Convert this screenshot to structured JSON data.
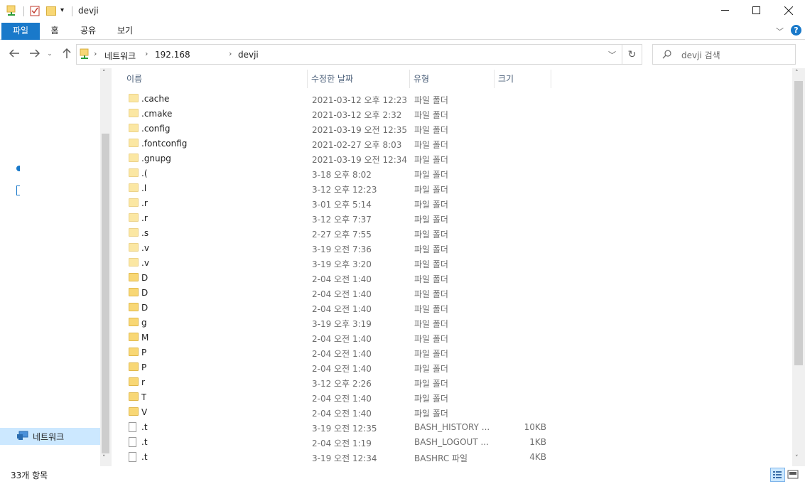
{
  "window": {
    "title": "devji",
    "minimize_icon": "minimize-icon",
    "maximize_icon": "maximize-icon",
    "close_icon": "close-icon"
  },
  "ribbon": {
    "tabs": [
      "파일",
      "홈",
      "공유",
      "보기"
    ],
    "active_tab": "파일",
    "accent_color": "#1979ca"
  },
  "address": {
    "breadcrumbs": [
      "네트워크",
      "192.168",
      "devji"
    ],
    "search_placeholder": "devji 검색"
  },
  "nav": {
    "network_label": "네트워크"
  },
  "columns": {
    "name": "이름",
    "date": "수정한 날짜",
    "type": "유형",
    "size": "크기"
  },
  "files": [
    {
      "name": ".cache",
      "date": "2021-03-12 오후 12:23",
      "type": "파일 폴더",
      "size": "",
      "kind": "folder"
    },
    {
      "name": ".cmake",
      "date": "2021-03-12 오후 2:32",
      "type": "파일 폴더",
      "size": "",
      "kind": "folder"
    },
    {
      "name": ".config",
      "date": "2021-03-19 오전 12:35",
      "type": "파일 폴더",
      "size": "",
      "kind": "folder"
    },
    {
      "name": ".fontconfig",
      "date": "2021-02-27 오후 8:03",
      "type": "파일 폴더",
      "size": "",
      "kind": "folder"
    },
    {
      "name": ".gnupg",
      "date": "2021-03-19 오전 12:34",
      "type": "파일 폴더",
      "size": "",
      "kind": "folder"
    },
    {
      "name": ".(",
      "date": "3-18 오후 8:02",
      "type": "파일 폴더",
      "size": "",
      "kind": "folder"
    },
    {
      "name": ".l",
      "date": "3-12 오후 12:23",
      "type": "파일 폴더",
      "size": "",
      "kind": "folder"
    },
    {
      "name": ".r",
      "date": "3-01 오후 5:14",
      "type": "파일 폴더",
      "size": "",
      "kind": "folder"
    },
    {
      "name": ".r",
      "date": "3-12 오후 7:37",
      "type": "파일 폴더",
      "size": "",
      "kind": "folder"
    },
    {
      "name": ".s",
      "date": "2-27 오후 7:55",
      "type": "파일 폴더",
      "size": "",
      "kind": "folder"
    },
    {
      "name": ".v",
      "date": "3-19 오전 7:36",
      "type": "파일 폴더",
      "size": "",
      "kind": "folder"
    },
    {
      "name": ".v",
      "date": "3-19 오후 3:20",
      "type": "파일 폴더",
      "size": "",
      "kind": "folder"
    },
    {
      "name": "D",
      "date": "2-04 오전 1:40",
      "type": "파일 폴더",
      "size": "",
      "kind": "folder"
    },
    {
      "name": "D",
      "date": "2-04 오전 1:40",
      "type": "파일 폴더",
      "size": "",
      "kind": "folder"
    },
    {
      "name": "D",
      "date": "2-04 오전 1:40",
      "type": "파일 폴더",
      "size": "",
      "kind": "folder"
    },
    {
      "name": "g",
      "date": "3-19 오후 3:19",
      "type": "파일 폴더",
      "size": "",
      "kind": "folder"
    },
    {
      "name": "M",
      "date": "2-04 오전 1:40",
      "type": "파일 폴더",
      "size": "",
      "kind": "folder"
    },
    {
      "name": "P",
      "date": "2-04 오전 1:40",
      "type": "파일 폴더",
      "size": "",
      "kind": "folder"
    },
    {
      "name": "P",
      "date": "2-04 오전 1:40",
      "type": "파일 폴더",
      "size": "",
      "kind": "folder"
    },
    {
      "name": "r",
      "date": "3-12 오후 2:26",
      "type": "파일 폴더",
      "size": "",
      "kind": "folder"
    },
    {
      "name": "T",
      "date": "2-04 오전 1:40",
      "type": "파일 폴더",
      "size": "",
      "kind": "folder"
    },
    {
      "name": "V",
      "date": "2-04 오전 1:40",
      "type": "파일 폴더",
      "size": "",
      "kind": "folder"
    },
    {
      "name": ".t",
      "date": "3-19 오전 12:35",
      "type": "BASH_HISTORY ...",
      "size": "10KB",
      "kind": "file"
    },
    {
      "name": ".t",
      "date": "2-04 오전 1:19",
      "type": "BASH_LOGOUT ...",
      "size": "1KB",
      "kind": "file"
    },
    {
      "name": ".t",
      "date": "3-19 오전 12:34",
      "type": "BASHRC 파일",
      "size": "4KB",
      "kind": "file"
    }
  ],
  "status": {
    "item_count": "33개 항목"
  }
}
